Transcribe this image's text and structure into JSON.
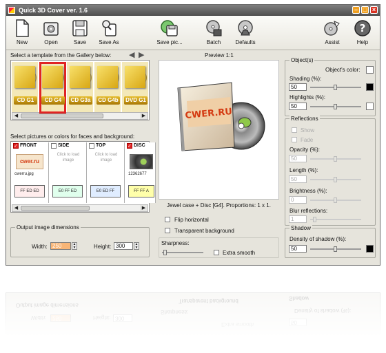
{
  "window": {
    "title": "Quick 3D Cover ver. 1.6"
  },
  "toolbar": {
    "new_label": "New",
    "open_label": "Open",
    "save_label": "Save",
    "save_as_label": "Save As",
    "save_pic_label": "Save pic...",
    "batch_label": "Batch",
    "defaults_label": "Defaults",
    "assist_label": "Assist",
    "help_label": "Help"
  },
  "gallery": {
    "label": "Select a template from the Gallery below:",
    "templates": [
      {
        "caption": "CD G1"
      },
      {
        "caption": "CD G4"
      },
      {
        "caption": "CD G3a"
      },
      {
        "caption": "CD G4b"
      },
      {
        "caption": "DVD G1"
      }
    ],
    "selected_index": 1
  },
  "faces": {
    "label": "Select pictures or colors for faces and background:",
    "items": [
      {
        "name": "FRONT",
        "checked": true,
        "image_text": "cwer.ru",
        "file": "cwerru.jpg",
        "color": "FF ED ED"
      },
      {
        "name": "SIDE",
        "checked": false,
        "hint": "Click to load image",
        "color": "E0 FF ED"
      },
      {
        "name": "TOP",
        "checked": false,
        "hint": "Click to load image",
        "color": "E0 ED FF"
      },
      {
        "name": "DISC",
        "checked": true,
        "file": "12362677",
        "color": "FF FF A"
      }
    ]
  },
  "output": {
    "group_label": "Output image dimensions",
    "width_label": "Width:",
    "width_value": "250",
    "height_label": "Height:",
    "height_value": "300"
  },
  "preview": {
    "label": "Preview 1:1",
    "cover_text": "CWER.RU",
    "caption": "Jewel case + Disc [G4]. Proportions: 1 x 1.",
    "flip_label": "Flip horizontal",
    "transparent_label": "Transparent background",
    "sharpness_label": "Sharpness:",
    "extra_smooth_label": "Extra smooth"
  },
  "objects": {
    "group_label": "Object(s)",
    "color_label": "Object's color:",
    "shading_label": "Shading (%):",
    "shading_value": "50",
    "highlights_label": "Highlights (%):",
    "highlights_value": "50"
  },
  "reflections": {
    "group_label": "Reflections",
    "show_label": "Show",
    "fade_label": "Fade",
    "opacity_label": "Opacity (%):",
    "opacity_value": "50",
    "length_label": "Length (%):",
    "length_value": "50",
    "brightness_label": "Brightness (%):",
    "brightness_value": "0",
    "blur_label": "Blur reflections:",
    "blur_value": "1"
  },
  "shadow": {
    "group_label": "Shadow",
    "density_label": "Density of shadow (%):",
    "density_value": "50"
  },
  "colors": {
    "accent_red": "#e02424",
    "template_gold": "#d8a714",
    "front_color": "#ffeded",
    "side_color": "#e0ffed",
    "top_color": "#e0edff",
    "disc_color": "#ffffaa"
  }
}
